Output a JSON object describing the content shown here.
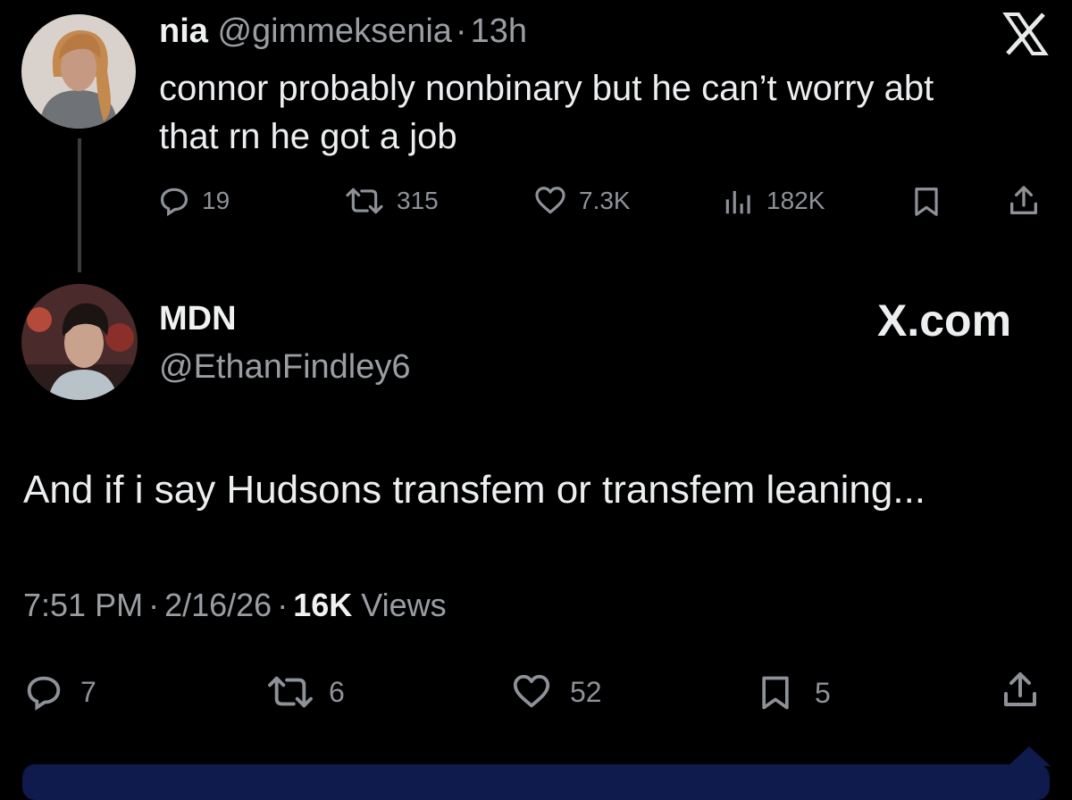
{
  "quoted_tweet": {
    "display_name": "nia",
    "handle": "@gimmeksenia",
    "separator": "·",
    "time": "13h",
    "text_line1": "connor probably nonbinary but he can’t worry abt",
    "text_line2": "that rn he got a job",
    "replies": "19",
    "reposts": "315",
    "likes": "7.3K",
    "views": "182K",
    "logo": "X"
  },
  "main_tweet": {
    "display_name": "MDN",
    "handle": "@EthanFindley6",
    "brand": "X.com",
    "text": "And if i say Hudsons transfem or transfem leaning...",
    "time": "7:51 PM",
    "sep1": "·",
    "date": "2/16/26",
    "sep2": "·",
    "view_count": "16K",
    "views_label": "Views",
    "replies": "7",
    "reposts": "6",
    "likes": "52",
    "bookmarks": "5"
  },
  "icons": {
    "reply": "reply-icon",
    "repost": "repost-icon",
    "like": "heart-icon",
    "views": "analytics-icon",
    "bookmark": "bookmark-icon",
    "share": "share-icon",
    "logo": "x-logo-icon"
  },
  "colors": {
    "background": "#000000",
    "text": "#e7e9ea",
    "muted": "#9a9ea3",
    "bottom_bar": "#0f1a4d"
  }
}
